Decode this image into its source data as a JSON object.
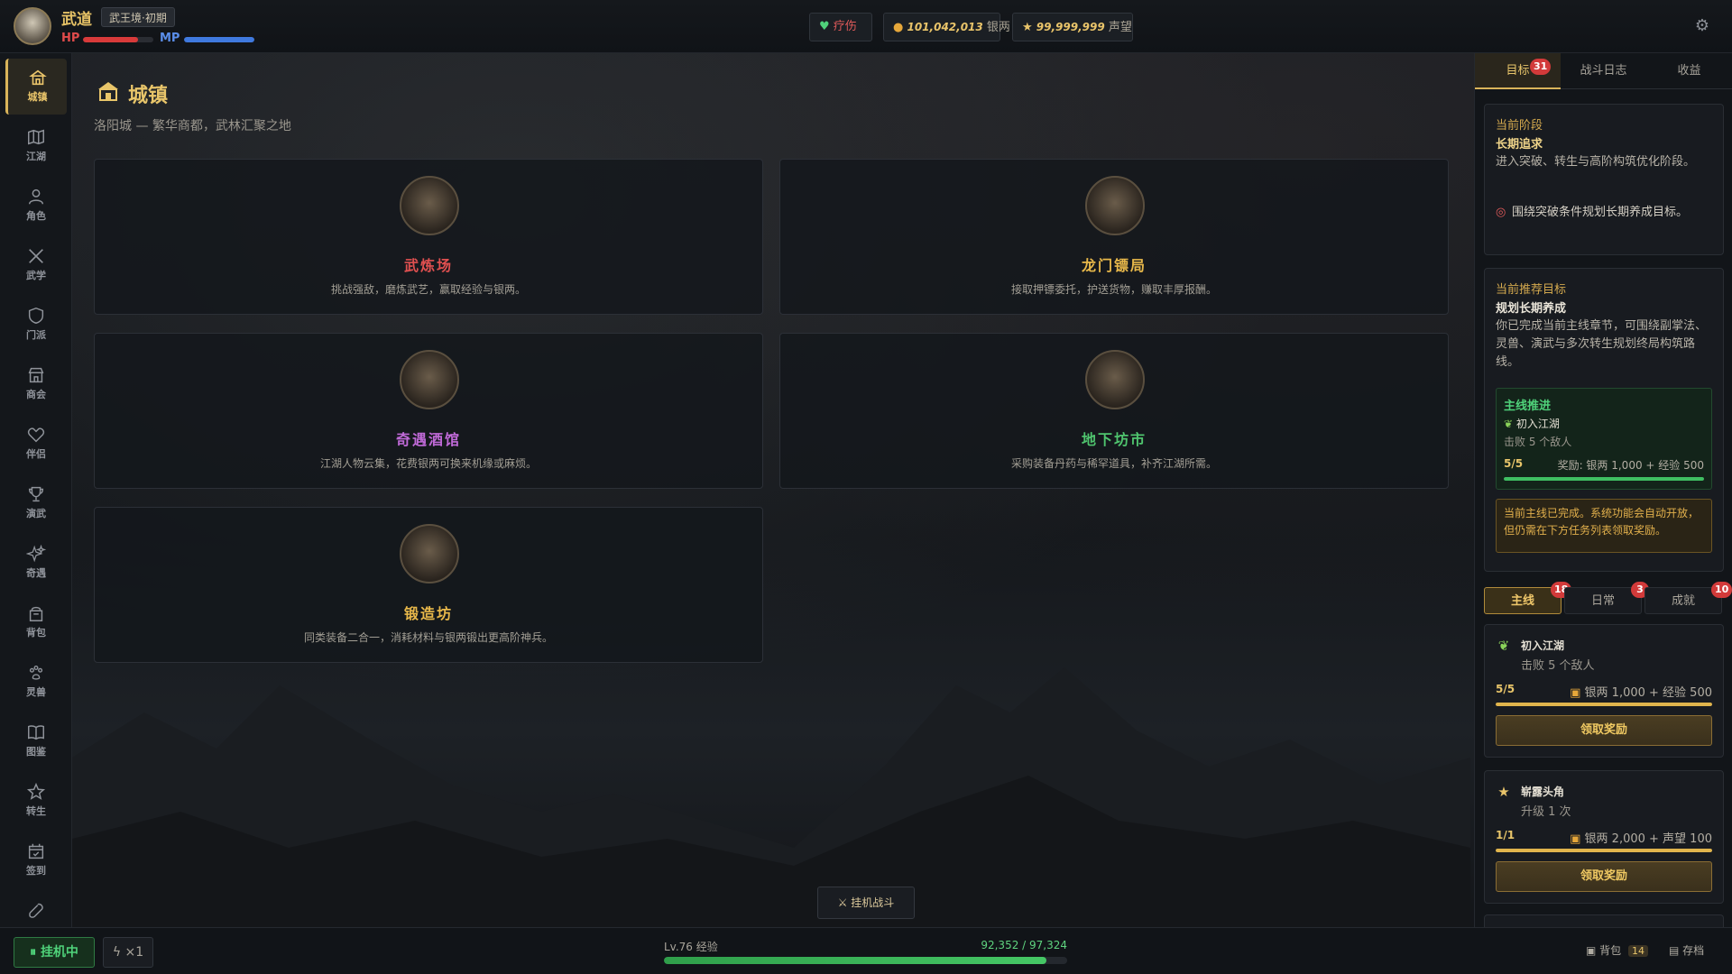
{
  "player": {
    "name": "武道",
    "realm": "武王境·初期",
    "hp_label": "HP",
    "mp_label": "MP",
    "hp_fraction": 0.78,
    "mp_fraction": 1.0
  },
  "topbar": {
    "heal_label": "疗伤",
    "silver_value": "101,042,013",
    "silver_unit": "银两",
    "reputation_value": "99,999,999",
    "reputation_unit": "声望"
  },
  "nav": {
    "items": [
      {
        "label": "城镇",
        "icon": "town-icon",
        "active": true
      },
      {
        "label": "江湖",
        "icon": "map-icon"
      },
      {
        "label": "角色",
        "icon": "user-icon"
      },
      {
        "label": "武学",
        "icon": "swords-icon"
      },
      {
        "label": "门派",
        "icon": "shield-icon"
      },
      {
        "label": "商会",
        "icon": "shop-icon"
      },
      {
        "label": "伴侣",
        "icon": "heart-icon"
      },
      {
        "label": "演武",
        "icon": "trophy-icon"
      },
      {
        "label": "奇遇",
        "icon": "sparkle-icon"
      },
      {
        "label": "背包",
        "icon": "backpack-icon"
      },
      {
        "label": "灵兽",
        "icon": "paw-icon"
      },
      {
        "label": "图鉴",
        "icon": "book-icon"
      },
      {
        "label": "转生",
        "icon": "star-icon"
      },
      {
        "label": "签到",
        "icon": "calendar-icon"
      },
      {
        "label": "",
        "icon": "wrench-icon"
      }
    ]
  },
  "main": {
    "title": "城镇",
    "subtitle": "洛阳城 — 繁华商都，武林汇聚之地",
    "buildings": [
      {
        "name": "武炼场",
        "desc": "挑战强敌，磨炼武艺，赢取经验与银两。",
        "color": "#e05050"
      },
      {
        "name": "龙门镖局",
        "desc": "接取押镖委托，护送货物，赚取丰厚报酬。",
        "color": "#e8b84a"
      },
      {
        "name": "奇遇酒馆",
        "desc": "江湖人物云集，花费银两可换来机缘或麻烦。",
        "color": "#c06ad8"
      },
      {
        "name": "地下坊市",
        "desc": "采购装备丹药与稀罕道具，补齐江湖所需。",
        "color": "#4fc46e"
      },
      {
        "name": "锻造坊",
        "desc": "同类装备二合一，消耗材料与银两锻出更高阶神兵。",
        "color": "#e8b84a"
      }
    ],
    "idle_battle_label": "⚔ 挂机战斗"
  },
  "right_panel": {
    "tabs": [
      {
        "label": "目标",
        "badge": "31",
        "active": true
      },
      {
        "label": "战斗日志"
      },
      {
        "label": "收益"
      }
    ],
    "stage": {
      "heading": "当前阶段",
      "name": "长期追求",
      "text": "进入突破、转生与高阶构筑优化阶段。",
      "tip": "围绕突破条件规划长期养成目标。"
    },
    "recommend": {
      "heading": "当前推荐目标",
      "title": "规划长期养成",
      "text": "你已完成当前主线章节，可围绕副掌法、灵兽、演武与多次转生规划终局构筑路线。",
      "main_progress": {
        "heading": "主线推进",
        "quest": "初入江湖",
        "desc": "击败 5 个敌人",
        "count": "5/5",
        "reward": "奖励: 银两 1,000 + 经验 500",
        "fraction": 1.0
      },
      "note": "当前主线已完成。系统功能会自动开放，但仍需在下方任务列表领取奖励。"
    },
    "quest_tabs": [
      {
        "label": "主线",
        "badge": "18",
        "active": true
      },
      {
        "label": "日常",
        "badge": "3"
      },
      {
        "label": "成就",
        "badge": "10"
      }
    ],
    "quests": [
      {
        "icon": "sprout-icon",
        "title": "初入江湖",
        "desc": "击败 5 个敌人",
        "count": "5/5",
        "reward": "银两 1,000 + 经验 500",
        "fraction": 1.0,
        "button": "领取奖励"
      },
      {
        "icon": "star-icon",
        "title": "崭露头角",
        "desc": "升级 1 次",
        "count": "1/1",
        "reward": "银两 2,000 + 声望 100",
        "fraction": 1.0,
        "button": "领取奖励"
      }
    ]
  },
  "bottombar": {
    "afk_label": "挂机中",
    "speed_label": "×1",
    "exp_label": "Lv.76 经验",
    "exp_value": "92,352 / 97,324",
    "exp_fraction": 0.949,
    "bag_label": "背包",
    "bag_count": "14",
    "save_label": "存档"
  }
}
